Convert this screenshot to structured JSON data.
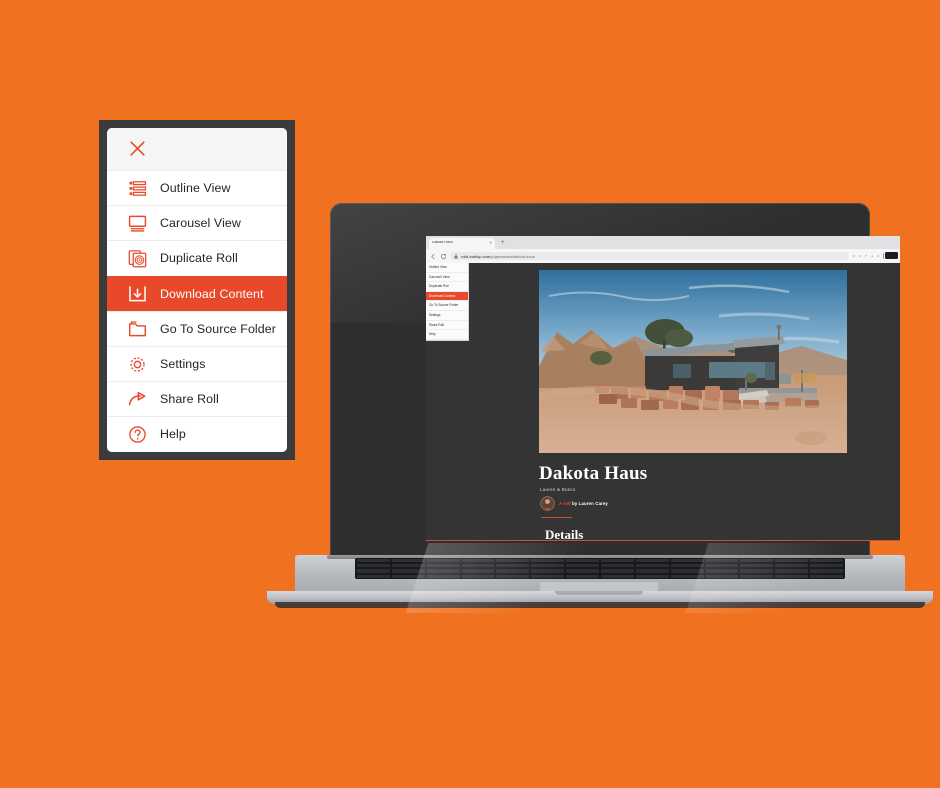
{
  "theme": {
    "background_color": "#f0711f",
    "accent_color": "#e8492b",
    "menu_icon_color": "#e8492b",
    "screen_bg_color": "#343434"
  },
  "menu": {
    "close_icon": "close-x-icon",
    "items": [
      {
        "label": "Outline View",
        "icon": "outline-view-icon",
        "active": false
      },
      {
        "label": "Carousel View",
        "icon": "carousel-view-icon",
        "active": false
      },
      {
        "label": "Duplicate Roll",
        "icon": "duplicate-roll-icon",
        "active": false
      },
      {
        "label": "Download Content",
        "icon": "download-icon",
        "active": true
      },
      {
        "label": "Go To Source Folder",
        "icon": "folder-icon",
        "active": false
      },
      {
        "label": "Settings",
        "icon": "gear-icon",
        "active": false
      },
      {
        "label": "Share Roll",
        "icon": "share-arrow-icon",
        "active": false
      },
      {
        "label": "Help",
        "icon": "question-mark-icon",
        "active": false
      }
    ]
  },
  "browser": {
    "tab_title": "Dakota Haus",
    "tab_close_glyph": "×",
    "new_tab_glyph": "+",
    "lock_glyph": "⌂",
    "url_domain": "rolls.bublup.com",
    "url_path": "/p/greatroad/dakota-haus",
    "toolbar_icons": [
      "search-icon",
      "star-icon",
      "reading-list-icon",
      "edit-icon",
      "bookmark-icon",
      "extension-icon",
      "account-icon",
      "cast-icon",
      "avatar"
    ],
    "toolbar_dot_colors": [
      "#4e9af1",
      "#d9534f",
      "#f0ad4e",
      "#5bc0de"
    ],
    "camera_chip": "camera-chip-icon"
  },
  "roll_page": {
    "hero_image_alt": "Desert house with stone wall and blue sky",
    "title": "Dakota Haus",
    "subtitle": "Lauren & Bosco",
    "byline_accent": "A roll",
    "byline_rest": " by Lauren Carey",
    "section_heading": "Details",
    "mini_menu_items": [
      {
        "label": "Outline View",
        "active": false
      },
      {
        "label": "Carousel View",
        "active": false
      },
      {
        "label": "Duplicate Roll",
        "active": false
      },
      {
        "label": "Download Content",
        "active": true
      },
      {
        "label": "Go To Source Folder",
        "active": false
      },
      {
        "label": "Settings",
        "active": false
      },
      {
        "label": "Share Roll",
        "active": false
      },
      {
        "label": "Help",
        "active": false
      }
    ]
  },
  "device": {
    "name": "laptop-illustration"
  }
}
